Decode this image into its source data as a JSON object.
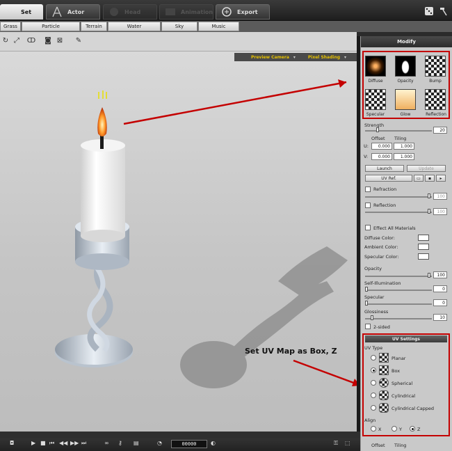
{
  "top_tabs": [
    {
      "label": "Set",
      "state": "active",
      "icon": "set-icon"
    },
    {
      "label": "Actor",
      "state": "normal",
      "icon": "actor-icon"
    },
    {
      "label": "Head",
      "state": "disabled",
      "icon": "head-icon"
    },
    {
      "label": "Animation",
      "state": "disabled",
      "icon": "animation-icon"
    },
    {
      "label": "Export",
      "state": "normal",
      "icon": "export-icon"
    }
  ],
  "sub_tabs": [
    "Grass",
    "Particle",
    "Terrain",
    "Water",
    "Sky",
    "Music"
  ],
  "viewport_options": {
    "camera": "Preview Camera",
    "shading": "Pixel Shading"
  },
  "panel": {
    "title": "Modify",
    "maps": [
      {
        "label": "Diffuse",
        "icon": "diffuse-map-icon"
      },
      {
        "label": "Opacity",
        "icon": "opacity-map-icon"
      },
      {
        "label": "Bump",
        "icon": "bump-map-icon"
      },
      {
        "label": "Specular",
        "icon": "specular-map-icon"
      },
      {
        "label": "Glow",
        "icon": "glow-map-icon"
      },
      {
        "label": "Reflection",
        "icon": "reflection-map-icon"
      }
    ],
    "strength_label": "Strength",
    "strength_value": "20",
    "offset_label": "Offset",
    "tiling_label": "Tiling",
    "u_label": "U:",
    "v_label": "V:",
    "u_offset": "0.000",
    "u_tiling": "1.000",
    "v_offset": "0.000",
    "v_tiling": "1.000",
    "launch_label": "Launch",
    "update_label": "Update",
    "uv_ref_label": "UV Ref.",
    "refraction_label": "Refraction",
    "refraction_value": "100",
    "reflection_label": "Reflection",
    "reflection_value": "100",
    "effect_all_label": "Effect All Materials",
    "diffuse_color_label": "Diffuse Color:",
    "ambient_color_label": "Ambient Color:",
    "specular_color_label": "Specular Color:",
    "opacity_label": "Opacity",
    "opacity_value": "100",
    "self_illum_label": "Self-Illumination",
    "self_illum_value": "0",
    "specular_label": "Specular",
    "specular_value": "0",
    "glossiness_label": "Glossiness",
    "glossiness_value": "10",
    "two_sided_label": "2-sided",
    "uv_settings_title": "UV Settings",
    "uv_type_label": "UV Type",
    "uv_types": [
      {
        "label": "Planar",
        "selected": false
      },
      {
        "label": "Box",
        "selected": true
      },
      {
        "label": "Spherical",
        "selected": false
      },
      {
        "label": "Cylindrical",
        "selected": false
      },
      {
        "label": "Cylindrical Capped",
        "selected": false
      }
    ],
    "align_label": "Align",
    "align_options": [
      {
        "label": "X",
        "selected": false
      },
      {
        "label": "Y",
        "selected": false
      },
      {
        "label": "Z",
        "selected": true
      }
    ],
    "bottom_offset_label": "Offset",
    "bottom_tiling_label": "Tiling"
  },
  "timeline": {
    "counter": "00000"
  },
  "annotation": "Set UV Map as Box, Z",
  "colors": {
    "highlight": "#c40000",
    "accent_yellow": "#e5c000"
  }
}
